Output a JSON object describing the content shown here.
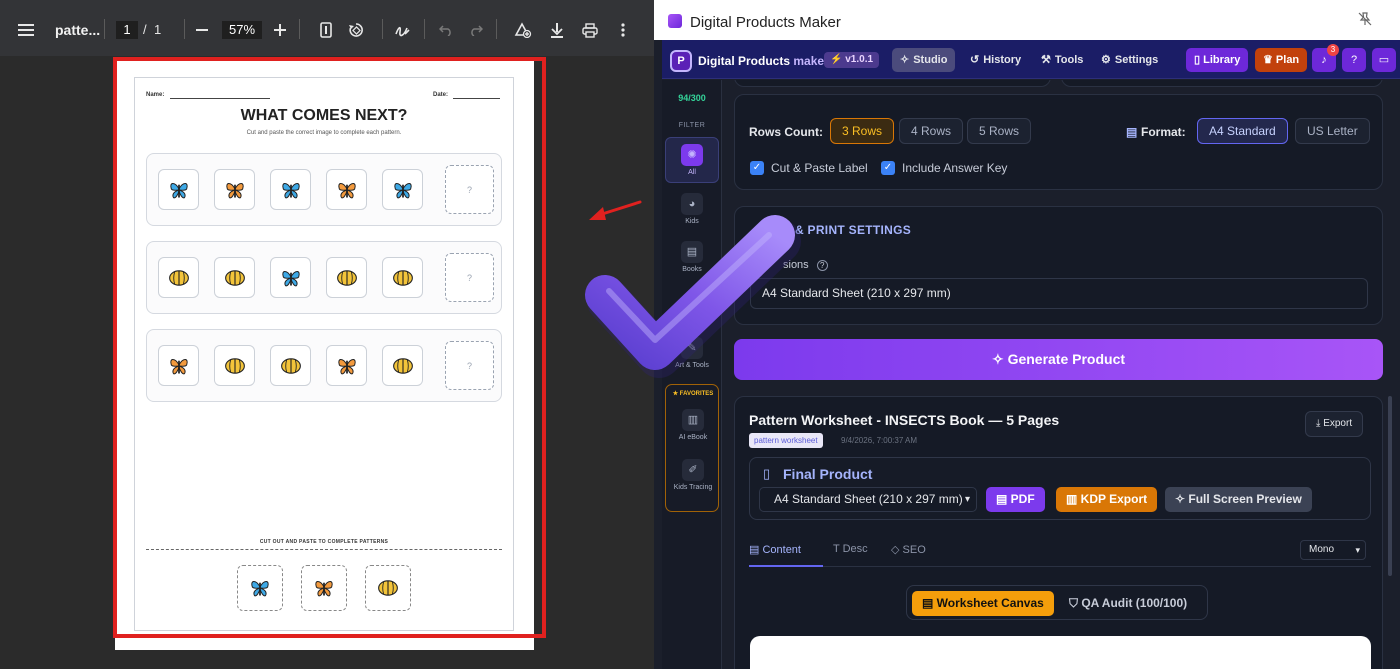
{
  "pdf_viewer": {
    "menu_icon": "hamburger-menu-icon",
    "file_name": "patte...",
    "page_current": "1",
    "page_sep": "/",
    "page_total": "1",
    "zoom": "57%",
    "toolbar_icons": [
      "zoom-out-icon",
      "zoom-in-icon",
      "fit-page-icon",
      "rotate-icon",
      "draw-icon",
      "undo-icon",
      "redo-icon",
      "add-annotation-icon",
      "download-icon",
      "print-icon",
      "more-options-icon"
    ],
    "highlight_color": "#e0211f"
  },
  "worksheet": {
    "name_label": "Name:",
    "date_label": "Date:",
    "title": "WHAT COMES NEXT?",
    "subtitle": "Cut and paste the correct image to complete each pattern.",
    "rows": [
      {
        "items": [
          "butterfly-blue",
          "butterfly-orange",
          "butterfly-blue",
          "butterfly-orange",
          "butterfly-blue"
        ],
        "blank": "?"
      },
      {
        "items": [
          "beetle-yellow",
          "beetle-yellow",
          "butterfly-blue",
          "beetle-yellow",
          "beetle-yellow"
        ],
        "blank": "?"
      },
      {
        "items": [
          "butterfly-orange",
          "beetle-yellow",
          "beetle-yellow",
          "butterfly-orange",
          "beetle-yellow"
        ],
        "blank": "?"
      }
    ],
    "cut_label": "CUT OUT AND PASTE TO COMPLETE PATTERNS",
    "cut_items": [
      "butterfly-blue",
      "butterfly-orange",
      "beetle-yellow"
    ],
    "colors": {
      "blue": "#3ea9e6",
      "orange": "#f39a3d",
      "yellow": "#f3c43a"
    }
  },
  "window": {
    "title": "Digital Products Maker",
    "pin_icon": "pin-icon"
  },
  "header": {
    "brand_main": "Digital Products",
    "brand_accent": "maker",
    "version": "v1.0.1",
    "nav": [
      {
        "label": "Studio",
        "icon": "wand-icon",
        "active": true
      },
      {
        "label": "History",
        "icon": "history-icon",
        "active": false
      },
      {
        "label": "Tools",
        "icon": "wrench-icon",
        "active": false
      },
      {
        "label": "Settings",
        "icon": "gear-icon",
        "active": false
      }
    ],
    "library": "Library",
    "plan": "Plan",
    "notif_count": "3"
  },
  "sidebar": {
    "credits": "94/300",
    "filter": "FILTER",
    "items": [
      {
        "label": "All",
        "icon": "sparkle-icon"
      },
      {
        "label": "Kids",
        "icon": "palette-icon"
      },
      {
        "label": "Books",
        "icon": "book-icon"
      },
      {
        "label": "Art & Tools",
        "icon": "tools-icon"
      }
    ],
    "favorites_label": "FAVORITES",
    "favorites": [
      {
        "label": "AI eBook",
        "icon": "ebook-icon"
      },
      {
        "label": "Kids Tracing",
        "icon": "tracing-icon"
      }
    ]
  },
  "settings": {
    "rows_label": "Rows Count:",
    "rows_options": [
      "3 Rows",
      "4 Rows",
      "5 Rows"
    ],
    "rows_selected": "3 Rows",
    "format_label": "Format:",
    "format_options": [
      "A4 Standard",
      "US Letter"
    ],
    "format_selected": "A4 Standard",
    "checkboxes": [
      {
        "label": "Cut & Paste Label",
        "checked": true
      },
      {
        "label": "Include Answer Key",
        "checked": true
      }
    ],
    "section_title": "E & PRINT SETTINGS",
    "dimensions_label": "sions",
    "dimensions_value": "A4 Standard Sheet (210 x 297 mm)"
  },
  "generate_label": "Generate Product",
  "product": {
    "title": "Pattern Worksheet - INSECTS Book — 5 Pages",
    "badge": "pattern worksheet",
    "date": "9/4/2026, 7:00:37 AM",
    "export": "Export",
    "final_title": "Final Product",
    "format_select": "A4 Standard Sheet (210 x 297 mm)",
    "pdf": "PDF",
    "kdp": "KDP Export",
    "fullscreen": "Full Screen Preview",
    "tabs": [
      "Content",
      "Desc",
      "SEO"
    ],
    "font_select": "Mono",
    "canvas_btn": "Worksheet Canvas",
    "qa_btn": "QA Audit (100/100)"
  }
}
